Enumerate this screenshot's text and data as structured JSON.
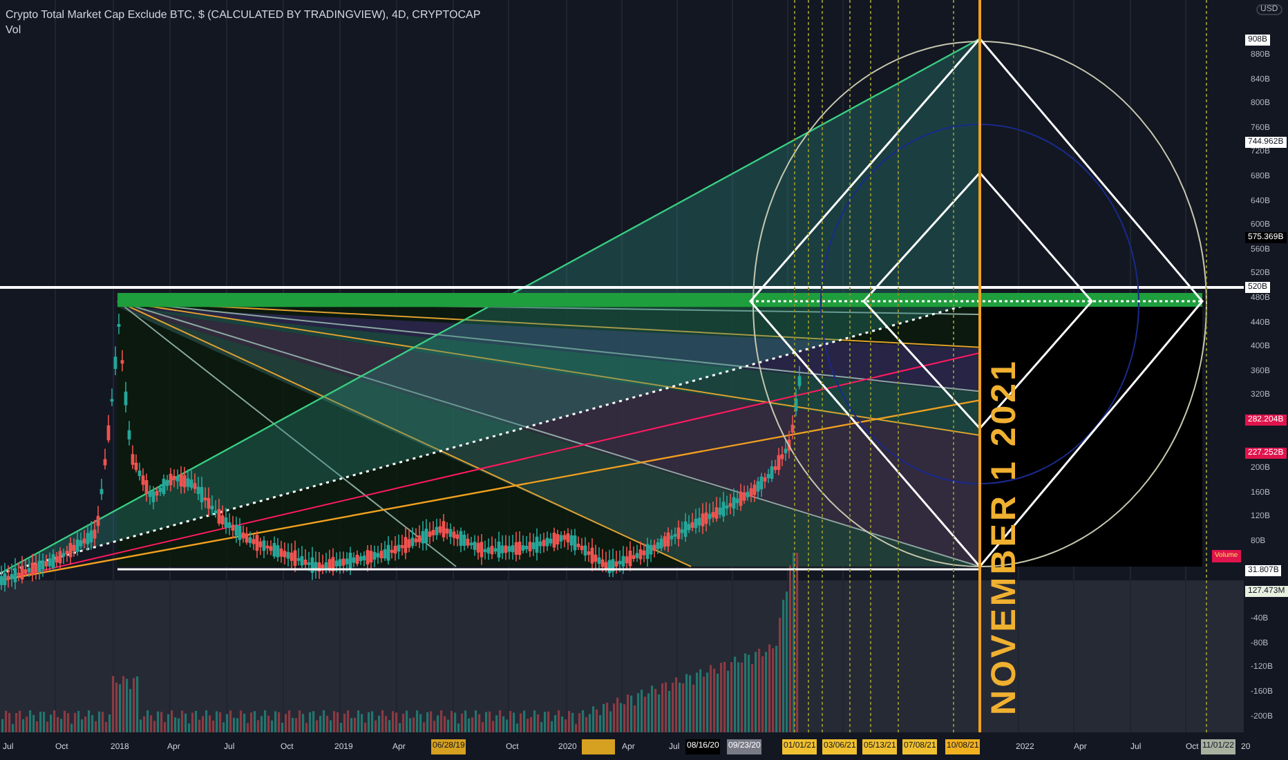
{
  "legend": {
    "title": "Crypto Total Market Cap Exclude BTC, $ (CALCULATED BY TRADINGVIEW), 4D, CRYPTOCAP",
    "indicator": "Vol"
  },
  "currency": "USD",
  "price_ticks": [
    "880B",
    "840B",
    "800B",
    "760B",
    "720B",
    "680B",
    "640B",
    "600B",
    "560B",
    "520B",
    "480B",
    "440B",
    "400B",
    "360B",
    "320B",
    "200B",
    "160B",
    "120B",
    "80B"
  ],
  "volume_ticks": [
    "-40B",
    "-80B",
    "-120B",
    "-160B",
    "-200B"
  ],
  "price_badges": [
    {
      "text": "908B",
      "color": "#ffffff"
    },
    {
      "text": "744.962B",
      "color": "#ffffff"
    },
    {
      "text": "575.369B",
      "color": "#000000"
    },
    {
      "text": "520B",
      "color": "#ffffff"
    },
    {
      "text": "282.204B",
      "color": "#e0144c"
    },
    {
      "text": "227.252B",
      "color": "#e0144c"
    },
    {
      "text": "31.807B",
      "color": "#ffffff"
    },
    {
      "text": "127.473M",
      "color": "#e8f0e0"
    }
  ],
  "volume_badge": "Volume",
  "annotation": "NOVEMBER 1 2021",
  "time_ticks": [
    "Jul",
    "Oct",
    "2018",
    "Apr",
    "Jul",
    "Oct",
    "2019",
    "Apr",
    "Oct",
    "2020",
    "Apr",
    "Jul",
    "2022",
    "Apr",
    "Jul",
    "Oct",
    "20"
  ],
  "time_badges": [
    {
      "text": "06/28/19",
      "color": "#d6a021"
    },
    {
      "text": "08/16/20",
      "color": "#000000"
    },
    {
      "text": "09/23/20",
      "color": "#787b86"
    },
    {
      "text": "01/01/21",
      "color": "#f0c030"
    },
    {
      "text": "03/06/21",
      "color": "#f0c030"
    },
    {
      "text": "05/13/21",
      "color": "#f0c030"
    },
    {
      "text": "07/08/21",
      "color": "#f0c030"
    },
    {
      "text": "10/08/21",
      "color": "#f0b020"
    },
    {
      "text": "11/01/22",
      "color": "#a8b0a0"
    }
  ]
}
